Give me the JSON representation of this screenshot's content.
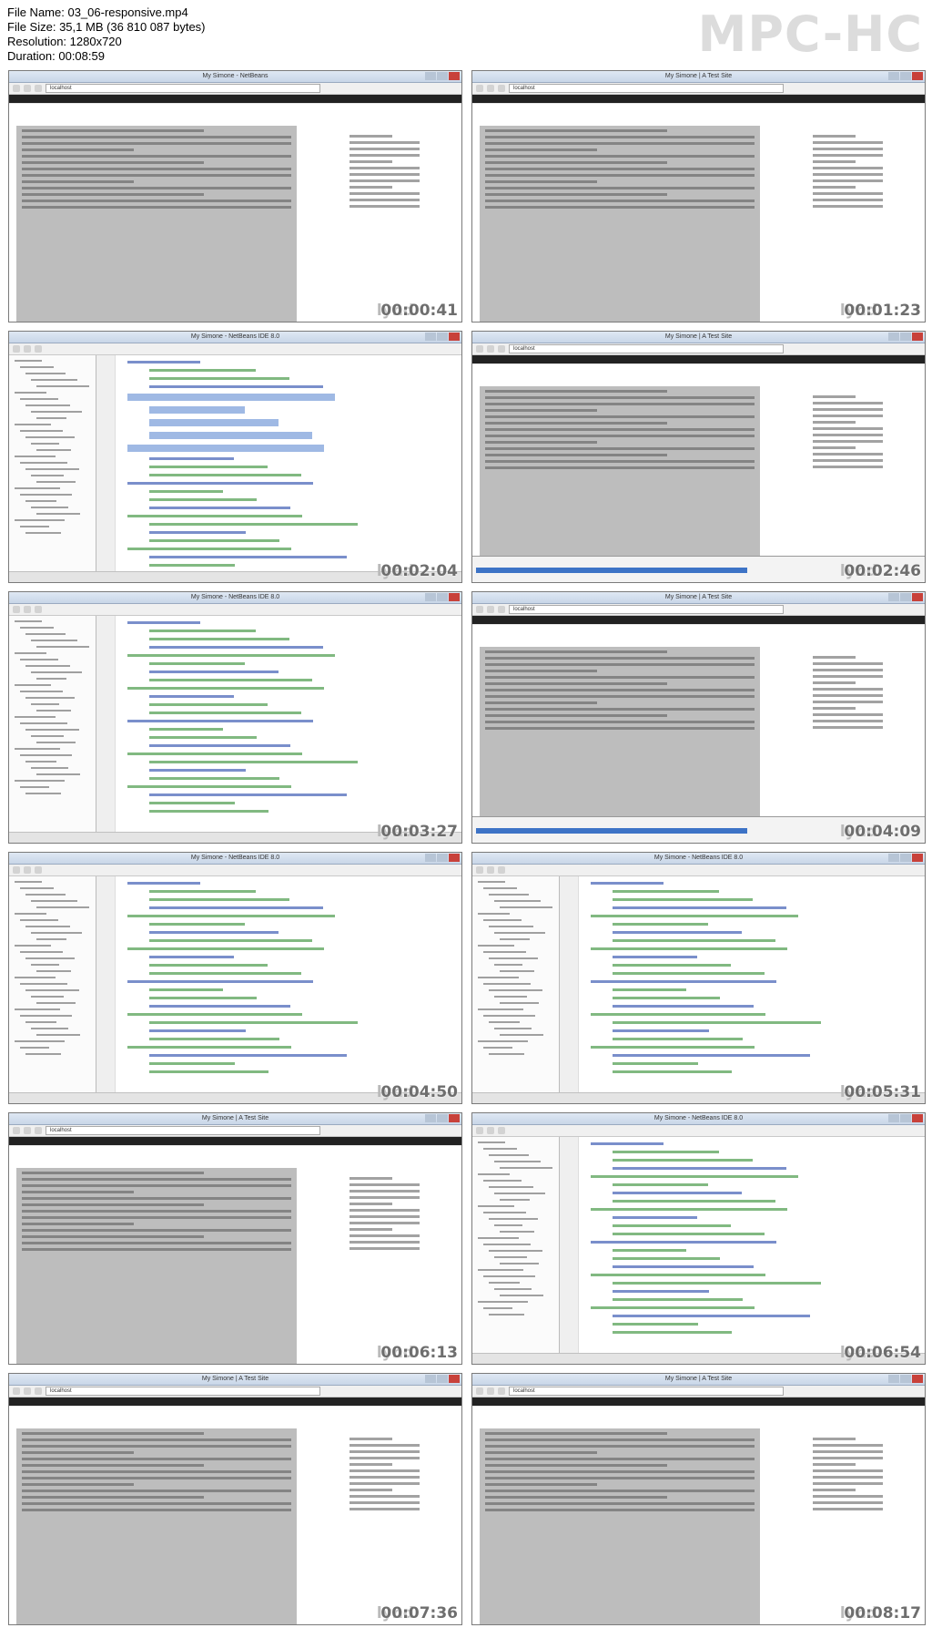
{
  "file_info": {
    "file_name": "File Name: 03_06-responsive.mp4",
    "file_size": "File Size: 35,1 MB (36 810 087 bytes)",
    "resolution": "Resolution: 1280x720",
    "duration": "Duration: 00:08:59"
  },
  "player_logo": "MPC-HC",
  "thumbnails": [
    {
      "type": "browser",
      "title": "My Simone - NetBeans",
      "addr": "localhost",
      "stamp": "00:00:41"
    },
    {
      "type": "browser",
      "title": "My Simone | A Test Site",
      "addr": "localhost",
      "stamp": "00:01:23"
    },
    {
      "type": "ide",
      "title": "My Simone - NetBeans IDE 8.0",
      "addr": "",
      "stamp": "00:02:04"
    },
    {
      "type": "browser",
      "title": "My Simone | A Test Site",
      "addr": "localhost",
      "stamp": "00:02:46"
    },
    {
      "type": "ide",
      "title": "My Simone - NetBeans IDE 8.0",
      "addr": "",
      "stamp": "00:03:27"
    },
    {
      "type": "browser",
      "title": "My Simone | A Test Site",
      "addr": "localhost",
      "stamp": "00:04:09"
    },
    {
      "type": "ide",
      "title": "My Simone - NetBeans IDE 8.0",
      "addr": "",
      "stamp": "00:04:50"
    },
    {
      "type": "ide",
      "title": "My Simone - NetBeans IDE 8.0",
      "addr": "",
      "stamp": "00:05:31"
    },
    {
      "type": "browser",
      "title": "My Simone | A Test Site",
      "addr": "localhost",
      "stamp": "00:06:13"
    },
    {
      "type": "ide",
      "title": "My Simone - NetBeans IDE 8.0",
      "addr": "",
      "stamp": "00:06:54"
    },
    {
      "type": "browser",
      "title": "My Simone | A Test Site",
      "addr": "localhost",
      "stamp": "00:07:36"
    },
    {
      "type": "browser",
      "title": "My Simone | A Test Site",
      "addr": "localhost",
      "stamp": "00:08:17"
    }
  ],
  "watermark": "lynd",
  "colors": {
    "titlebar": "#c8d6e8",
    "wp_adminbar": "#222222",
    "content_gray": "#bdbdbd",
    "selection_blue": "#3d73c6"
  }
}
